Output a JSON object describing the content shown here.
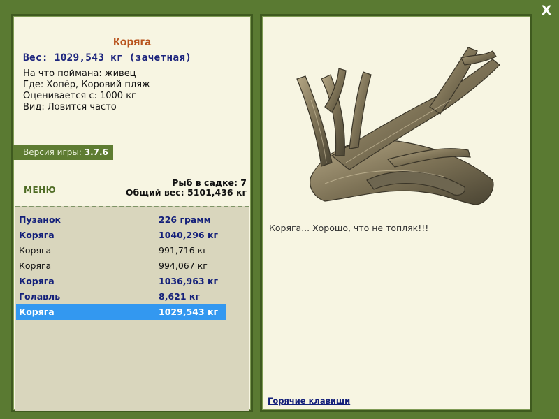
{
  "window": {
    "close_label": "X"
  },
  "fish": {
    "name": "Коряга",
    "weight_line": "Вес: 1029,543 кг (зачетная)",
    "bait_line": "На что поймана: живец",
    "place_line": "Где: Хопёр, Коровий пляж",
    "rated_line": "Оценивается с: 1000 кг",
    "view_line": "Вид: Ловится часто",
    "comment": "Коряга... Хорошо, что не топляк!!!",
    "image_icon": "driftwood-image"
  },
  "version": {
    "label": "Версия игры: ",
    "value": "3.7.6"
  },
  "menu_label": "МЕНЮ",
  "summary": {
    "count_line": "Рыб в садке: 7",
    "total_line": "Общий вес: 5101,436 кг"
  },
  "catch_list": [
    {
      "name": "Пузанок",
      "weight": "226 грамм",
      "bold": true,
      "selected": false
    },
    {
      "name": "Коряга",
      "weight": "1040,296 кг",
      "bold": true,
      "selected": false
    },
    {
      "name": "Коряга",
      "weight": "991,716 кг",
      "bold": false,
      "selected": false
    },
    {
      "name": "Коряга",
      "weight": "994,067 кг",
      "bold": false,
      "selected": false
    },
    {
      "name": "Коряга",
      "weight": "1036,963 кг",
      "bold": true,
      "selected": false
    },
    {
      "name": "Голавль",
      "weight": "8,621 кг",
      "bold": true,
      "selected": false
    },
    {
      "name": "Коряга",
      "weight": "1029,543 кг",
      "bold": true,
      "selected": true
    }
  ],
  "hotkeys_label": "Горячие клавиши",
  "colors": {
    "frame": "#5a7a32",
    "panel_bg": "#f7f5e2",
    "list_bg": "#d9d6bd",
    "title": "#b8521c",
    "highlight_text": "#14207a",
    "selected_row": "#3398f0"
  }
}
